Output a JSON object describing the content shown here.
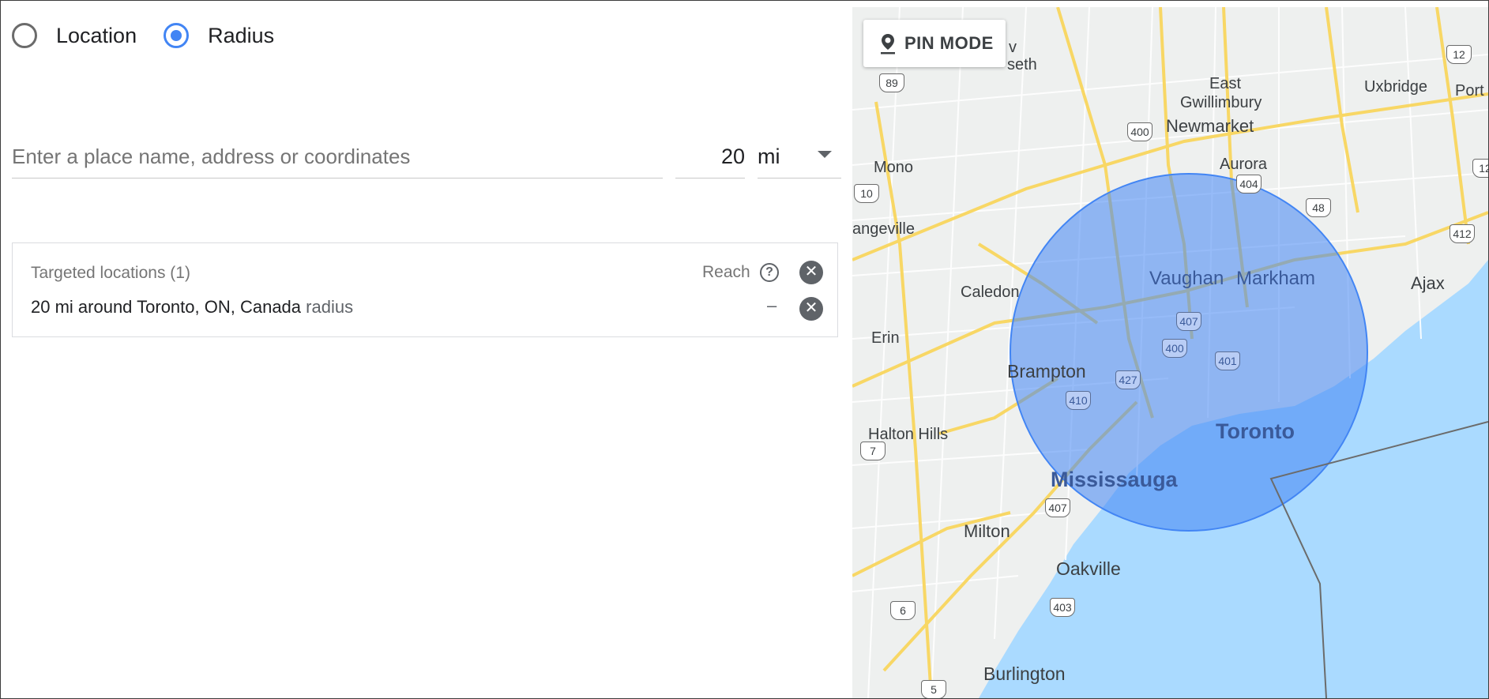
{
  "mode": {
    "options": [
      "Location",
      "Radius"
    ],
    "selected": "Radius"
  },
  "search": {
    "placeholder": "Enter a place name, address or coordinates",
    "value": ""
  },
  "radius": {
    "value": "20",
    "unit": "mi"
  },
  "targets": {
    "header": "Targeted locations (1)",
    "reach_label": "Reach",
    "items": [
      {
        "text": "20 mi around Toronto, ON, Canada",
        "tag": "radius",
        "reach": "–"
      }
    ]
  },
  "map": {
    "pin_mode_label": "PIN MODE",
    "cities": [
      {
        "label": "East Gwillimbury"
      },
      {
        "label": "Newmarket"
      },
      {
        "label": "Uxbridge"
      },
      {
        "label": "Aurora"
      },
      {
        "label": "Mono"
      },
      {
        "label": "angeville"
      },
      {
        "label": "Caledon"
      },
      {
        "label": "Erin"
      },
      {
        "label": "Brampton"
      },
      {
        "label": "Vaughan"
      },
      {
        "label": "Markham"
      },
      {
        "label": "Ajax"
      },
      {
        "label": "Toronto"
      },
      {
        "label": "Halton Hills"
      },
      {
        "label": "Mississauga"
      },
      {
        "label": "Milton"
      },
      {
        "label": "Oakville"
      },
      {
        "label": "Burlington"
      },
      {
        "label": "Port"
      },
      {
        "label": "seth"
      },
      {
        "label": "v"
      }
    ],
    "highways": [
      "89",
      "400",
      "404",
      "48",
      "12",
      "10",
      "412",
      "407",
      "400",
      "401",
      "427",
      "410",
      "7",
      "407",
      "403",
      "6",
      "5",
      "12"
    ],
    "radius_circle_color": "#4285f4",
    "water_color": "#aadaff"
  }
}
